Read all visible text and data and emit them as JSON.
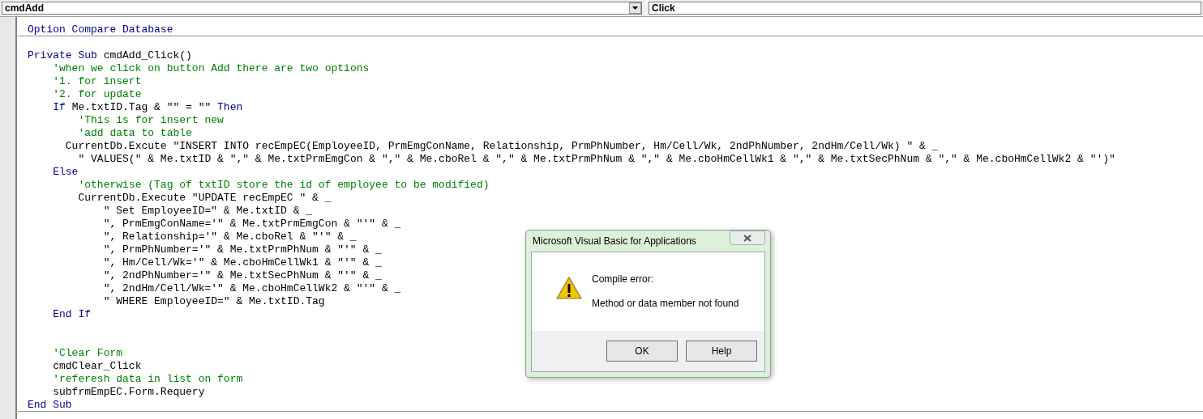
{
  "toolbar": {
    "object_box": {
      "value": "cmdAdd"
    },
    "procedure_box": {
      "value": "Click"
    }
  },
  "code_lines": [
    {
      "divider": true,
      "segments": [
        {
          "kind": "keyword",
          "text": "Option Compare Database"
        }
      ]
    },
    {
      "divider": false
    },
    {
      "divider": false,
      "segments": [
        {
          "kind": "keyword",
          "text": "Private Sub"
        },
        {
          "kind": "plain",
          "text": " cmdAdd_Click()"
        }
      ]
    },
    {
      "divider": false,
      "segments": [
        {
          "kind": "comment",
          "text": "    'when we click on button Add there are two options"
        }
      ]
    },
    {
      "divider": false,
      "segments": [
        {
          "kind": "comment",
          "text": "    '1. for insert"
        }
      ]
    },
    {
      "divider": false,
      "segments": [
        {
          "kind": "comment",
          "text": "    '2. for update"
        }
      ]
    },
    {
      "divider": false,
      "segments": [
        {
          "kind": "keyword",
          "text": "    If"
        },
        {
          "kind": "plain",
          "text": " Me.txtID.Tag & \"\" = \"\" "
        },
        {
          "kind": "keyword",
          "text": "Then"
        }
      ]
    },
    {
      "divider": false,
      "segments": [
        {
          "kind": "comment",
          "text": "        'This is for insert new"
        }
      ]
    },
    {
      "divider": false,
      "segments": [
        {
          "kind": "comment",
          "text": "        'add data to table"
        }
      ]
    },
    {
      "divider": false,
      "segments": [
        {
          "kind": "plain",
          "text": "      CurrentDb.Excute \"INSERT INTO recEmpEC(EmployeeID, PrmEmgConName, Relationship, PrmPhNumber, Hm/Cell/Wk, 2ndPhNumber, 2ndHm/Cell/Wk) \" & _"
        }
      ]
    },
    {
      "divider": false,
      "segments": [
        {
          "kind": "plain",
          "text": "        \" VALUES(\" & Me.txtID & \",\" & Me.txtPrmEmgCon & \",\" & Me.cboRel & \",\" & Me.txtPrmPhNum & \",\" & Me.cboHmCellWk1 & \",\" & Me.txtSecPhNum & \",\" & Me.cboHmCellWk2 & \"')\""
        }
      ]
    },
    {
      "divider": false,
      "segments": [
        {
          "kind": "keyword",
          "text": "    Else"
        }
      ]
    },
    {
      "divider": false,
      "segments": [
        {
          "kind": "comment",
          "text": "        'otherwise (Tag of txtID store the id of employee to be modified)"
        }
      ]
    },
    {
      "divider": false,
      "segments": [
        {
          "kind": "plain",
          "text": "        CurrentDb.Execute \"UPDATE recEmpEC \" & _"
        }
      ]
    },
    {
      "divider": false,
      "segments": [
        {
          "kind": "plain",
          "text": "            \" Set EmployeeID=\" & Me.txtID & _"
        }
      ]
    },
    {
      "divider": false,
      "segments": [
        {
          "kind": "plain",
          "text": "            \", PrmEmgConName='\" & Me.txtPrmEmgCon & \"'\" & _"
        }
      ]
    },
    {
      "divider": false,
      "segments": [
        {
          "kind": "plain",
          "text": "            \", Relationship='\" & Me.cboRel & \"'\" & _"
        }
      ]
    },
    {
      "divider": false,
      "segments": [
        {
          "kind": "plain",
          "text": "            \", PrmPhNumber='\" & Me.txtPrmPhNum & \"'\" & _"
        }
      ]
    },
    {
      "divider": false,
      "segments": [
        {
          "kind": "plain",
          "text": "            \", Hm/Cell/Wk='\" & Me.cboHmCellWk1 & \"'\" & _"
        }
      ]
    },
    {
      "divider": false,
      "segments": [
        {
          "kind": "plain",
          "text": "            \", 2ndPhNumber='\" & Me.txtSecPhNum & \"'\" & _"
        }
      ]
    },
    {
      "divider": false,
      "segments": [
        {
          "kind": "plain",
          "text": "            \", 2ndHm/Cell/Wk='\" & Me.cboHmCellWk2 & \"'\" & _"
        }
      ]
    },
    {
      "divider": false,
      "segments": [
        {
          "kind": "plain",
          "text": "            \" WHERE EmployeeID=\" & Me.txtID.Tag"
        }
      ]
    },
    {
      "divider": false,
      "segments": [
        {
          "kind": "keyword",
          "text": "    End If"
        }
      ]
    },
    {
      "divider": false
    },
    {
      "divider": false
    },
    {
      "divider": false,
      "segments": [
        {
          "kind": "comment",
          "text": "    'Clear Form"
        }
      ]
    },
    {
      "divider": false,
      "segments": [
        {
          "kind": "plain",
          "text": "    cmdClear_Click"
        }
      ]
    },
    {
      "divider": false,
      "segments": [
        {
          "kind": "comment",
          "text": "    'referesh data in list on form"
        }
      ]
    },
    {
      "divider": false,
      "segments": [
        {
          "kind": "plain",
          "text": "    subfrmEmpEC.Form.Requery"
        }
      ]
    },
    {
      "divider": true,
      "segments": [
        {
          "kind": "keyword",
          "text": "End Sub"
        }
      ]
    }
  ],
  "dialog": {
    "title": "Microsoft Visual Basic for Applications",
    "heading": "Compile error:",
    "message": "Method or data member not found",
    "buttons": [
      {
        "label": "OK"
      },
      {
        "label": "Help"
      }
    ]
  }
}
